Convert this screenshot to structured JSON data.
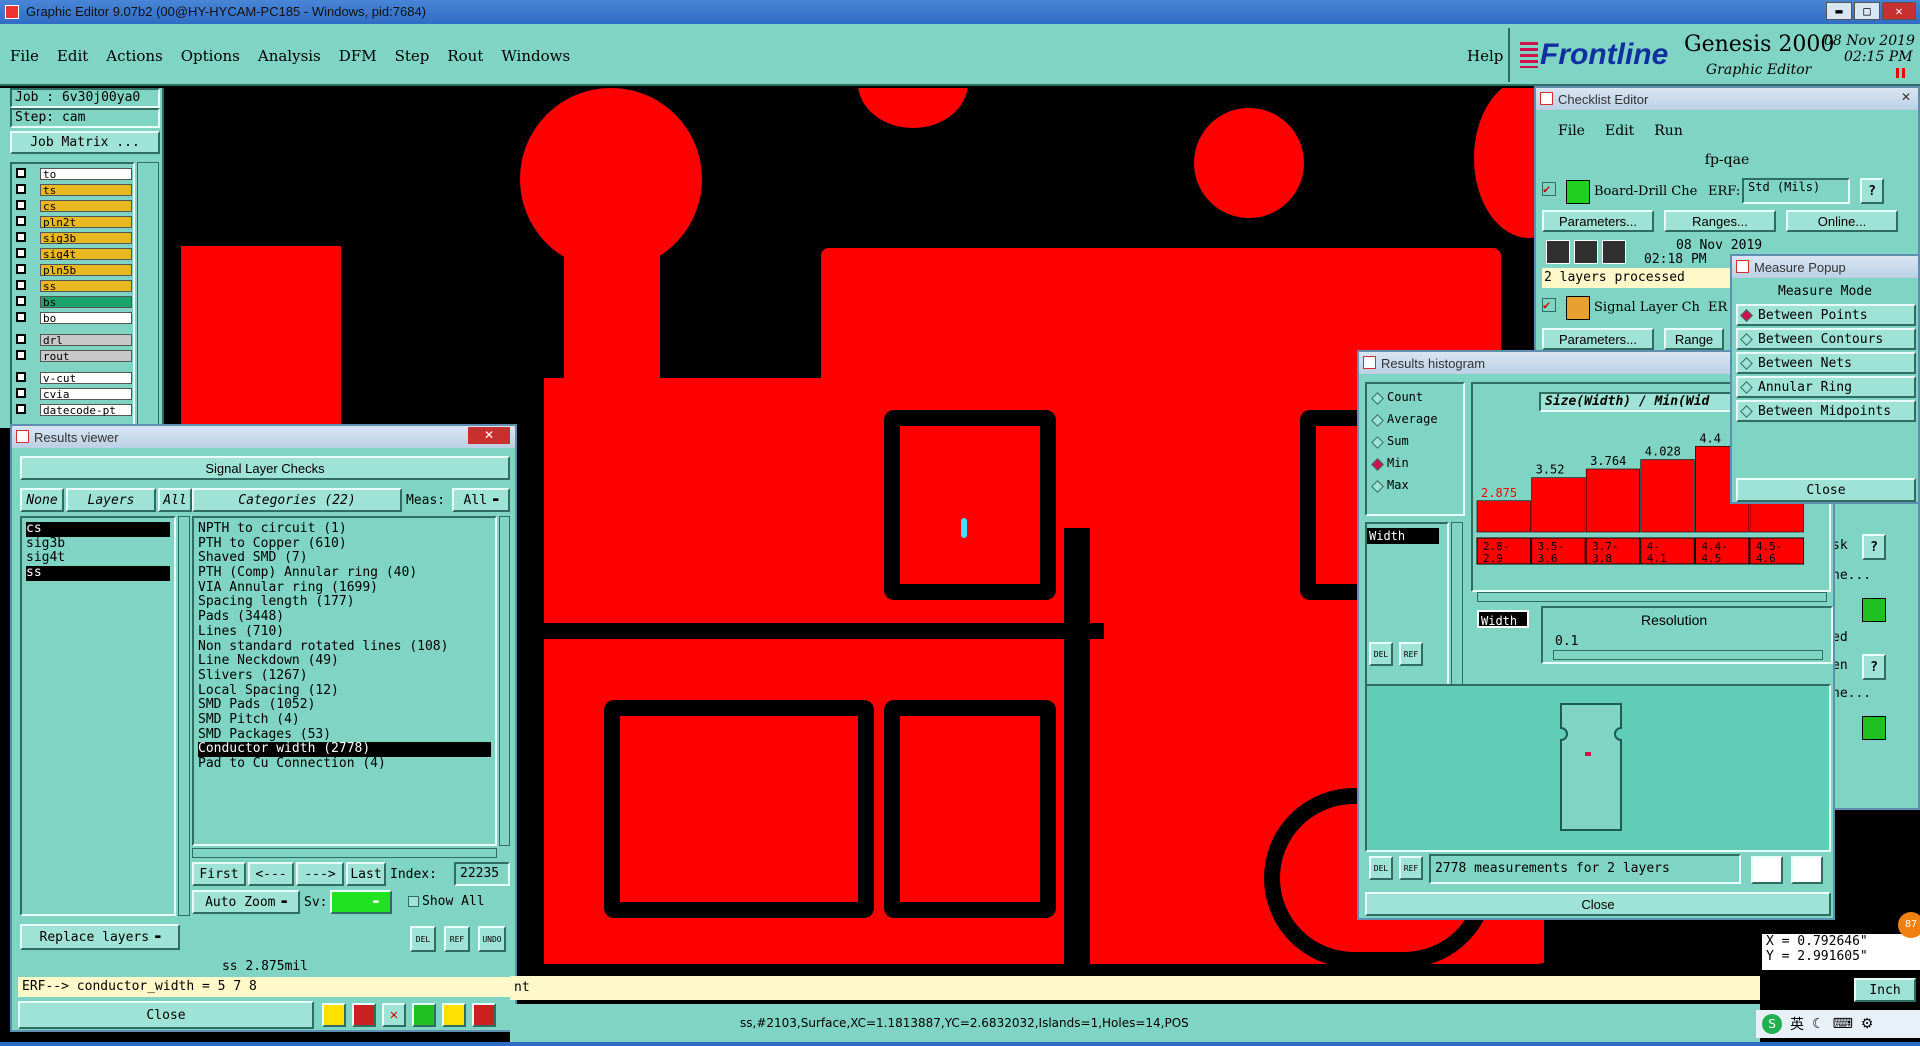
{
  "window": {
    "title": "Graphic Editor 9.07b2 (00@HY-HYCAM-PC185 - Windows, pid:7684)"
  },
  "menubar": {
    "items": [
      "File",
      "Edit",
      "Actions",
      "Options",
      "Analysis",
      "DFM",
      "Step",
      "Rout",
      "Windows"
    ],
    "help": "Help"
  },
  "brand": {
    "logo": "Frontline",
    "product": "Genesis 2000",
    "subtitle": "Graphic Editor",
    "date": "08 Nov 2019",
    "time": "02:15 PM"
  },
  "job": {
    "job_label": "Job : 6v30j00ya0",
    "step_label": "Step: cam",
    "matrix_button": "Job Matrix ..."
  },
  "layers": [
    {
      "name": "to",
      "color": "#ffffff"
    },
    {
      "name": "ts",
      "color": "#e8b820"
    },
    {
      "name": "cs",
      "color": "#e8b820"
    },
    {
      "name": "pln2t",
      "color": "#e8b820"
    },
    {
      "name": "sig3b",
      "color": "#e8b820"
    },
    {
      "name": "sig4t",
      "color": "#e8b820"
    },
    {
      "name": "pln5b",
      "color": "#e8b820"
    },
    {
      "name": "ss",
      "color": "#e8b820"
    },
    {
      "name": "bs",
      "color": "#1aa36a"
    },
    {
      "name": "bo",
      "color": "#ffffff"
    },
    {
      "name": "drl",
      "color": "#c8c8c8"
    },
    {
      "name": "rout",
      "color": "#c8c8c8"
    },
    {
      "name": "v-cut",
      "color": "#ffffff"
    },
    {
      "name": "cvia",
      "color": "#ffffff"
    },
    {
      "name": "datecode-pt",
      "color": "#ffffff"
    }
  ],
  "results_viewer": {
    "title": "Results viewer",
    "header": "Signal Layer Checks",
    "none": "None",
    "layers": "Layers",
    "all": "All",
    "categories": "Categories (22)",
    "meas_label": "Meas:",
    "meas_value": "All",
    "layer_list": [
      "cs",
      "sig3b",
      "sig4t",
      "ss"
    ],
    "category_list": [
      "NPTH to circuit (1)",
      "PTH to Copper (610)",
      "Shaved SMD (7)",
      "PTH (Comp) Annular ring (40)",
      "VIA Annular ring (1699)",
      "Spacing length (177)",
      "Pads (3448)",
      "Lines (710)",
      "Non standard rotated lines (108)",
      "Line Neckdown (49)",
      "Slivers (1267)",
      "Local Spacing (12)",
      "SMD Pads (1052)",
      "SMD Pitch (4)",
      "SMD Packages (53)",
      "Conductor width (2778)",
      "Pad to Cu Connection (4)"
    ],
    "selected_category": 15,
    "nav": {
      "first": "First",
      "prev": "<---",
      "next": "--->",
      "last": "Last",
      "index_label": "Index:",
      "index_value": "22235"
    },
    "auto_zoom": "Auto Zoom",
    "sv": "Sv:",
    "show_all": "Show All",
    "replace_layers": "Replace layers",
    "small_btns": [
      "DEL",
      "REF",
      "UNDO"
    ],
    "status": "ss 2.875mil",
    "erf": "ERF--> conductor_width = 5 7 8",
    "close": "Close"
  },
  "checklist": {
    "title": "Checklist Editor",
    "menu": [
      "File",
      "Edit",
      "Run"
    ],
    "name": "fp-qae",
    "item1": {
      "name": "Board-Drill Che",
      "erf": "ERF:",
      "erf_value": "Std (Mils)"
    },
    "buttons": {
      "params": "Parameters...",
      "ranges": "Ranges...",
      "online": "Online..."
    },
    "date": "08 Nov 2019",
    "time": "02:18 PM",
    "processed": "2 layers processed",
    "item2": {
      "name": "Signal Layer Ch",
      "erf": "ER"
    },
    "ranges2": "Range",
    "side_frags": [
      "sk",
      "ne...",
      "ed",
      "en",
      "ne..."
    ]
  },
  "histogram": {
    "title": "Results histogram",
    "radios": [
      {
        "label": "Count",
        "on": false
      },
      {
        "label": "Average",
        "on": false
      },
      {
        "label": "Sum",
        "on": false
      },
      {
        "label": "Min",
        "on": true
      },
      {
        "label": "Max",
        "on": false
      }
    ],
    "width_tag": "Width",
    "header": "Size(Width) / Min(Wid",
    "resolution_label": "Resolution",
    "resolution_value": "0.1",
    "width_tag2": "Width",
    "summary": "2778 measurements for 2 layers",
    "close": "Close",
    "del": "DEL",
    "ref": "REF"
  },
  "chart_data": {
    "type": "bar",
    "title": "Size(Width) / Min(Wid",
    "categories": [
      "2.8-2.9",
      "3.5-3.6",
      "3.7-3.8",
      "4-4.1",
      "4.4-4.5",
      "4.5-4.6"
    ],
    "values": [
      2.875,
      3.52,
      3.764,
      4.028,
      4.4,
      4.5
    ],
    "value_labels": [
      "2.875",
      "3.52",
      "3.764",
      "4.028",
      "4.4",
      ""
    ],
    "cat_lines": [
      [
        "2.8-",
        "2.9"
      ],
      [
        "3.5-",
        "3.6"
      ],
      [
        "3.7-",
        "3.8"
      ],
      [
        "4-",
        "4.1"
      ],
      [
        "4.4-",
        "4.5"
      ],
      [
        "4.5-",
        "4.6"
      ]
    ],
    "colors": {
      "bar": "#ff0000",
      "first_label": "#ff0000",
      "other_label": "#000000"
    }
  },
  "measure": {
    "title": "Measure Popup",
    "header": "Measure Mode",
    "options": [
      "Between Points",
      "Between Contours",
      "Between Nets",
      "Annular Ring",
      "Between Midpoints"
    ],
    "selected": 0,
    "close": "Close"
  },
  "coords": {
    "x": "X = 0.792646\"",
    "y": "Y = 2.991605\""
  },
  "units": "Inch",
  "status_bar": "ss,#2103,Surface,XC=1.1813887,YC=2.6832032,Islands=1,Holes=14,POS",
  "status_left": "nt",
  "taskbar": {
    "ime": "英",
    "badge": "87"
  },
  "colors": {
    "panel": "#7fd4c4",
    "copper": "#ff0000",
    "background": "#000000",
    "accent": "#d0104c"
  }
}
